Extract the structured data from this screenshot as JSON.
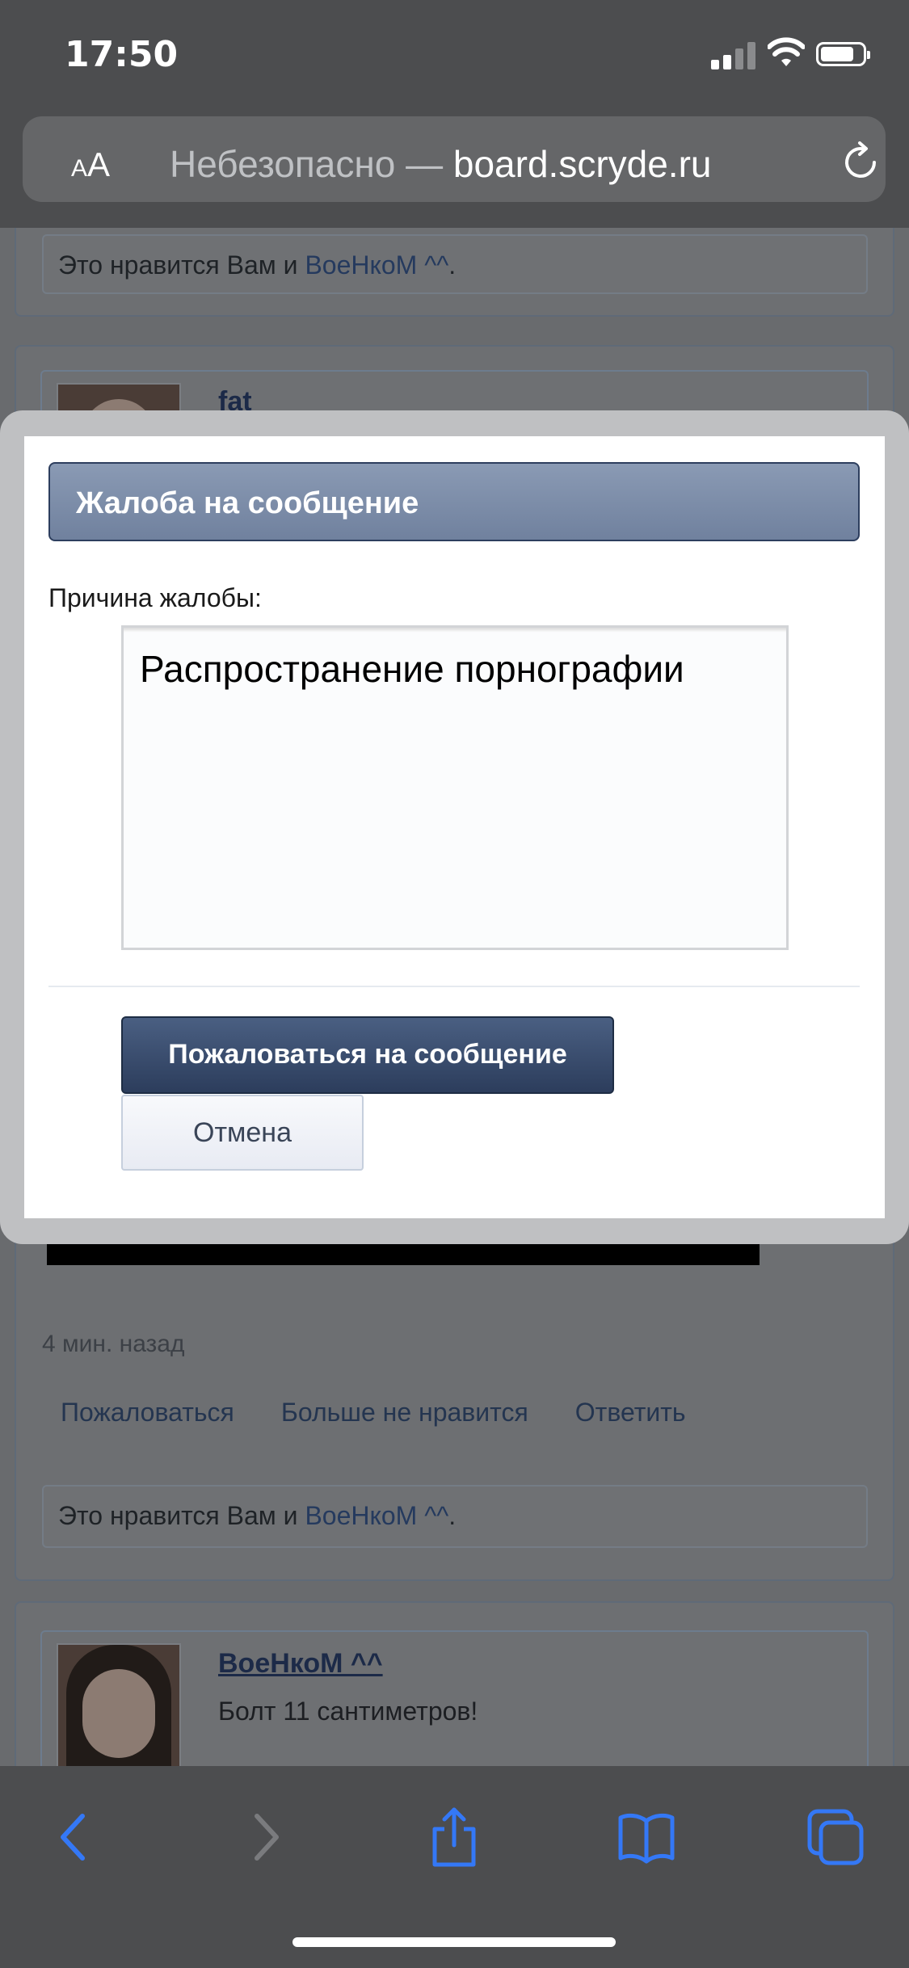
{
  "status_bar": {
    "time": "17:50"
  },
  "browser": {
    "text_size_label_small": "A",
    "text_size_label_large": "A",
    "url_insecure_label": "Небезопасно —",
    "url_domain": "board.scryde.ru"
  },
  "background_page": {
    "likes_top": {
      "prefix": "Это нравится Вам и",
      "user": "ВоеНкоМ ^^",
      "suffix": "."
    },
    "post1_author": "fat",
    "post_time": "4 мин. назад",
    "actions": [
      "Пожаловаться",
      "Больше не нравится",
      "Ответить"
    ],
    "likes_bottom": {
      "prefix": "Это нравится Вам и",
      "user": "ВоеНкоМ ^^",
      "suffix": "."
    },
    "post2_author": "ВоеНкоМ ^^",
    "post2_text": "Болт 11 сантиметров!"
  },
  "modal": {
    "title": "Жалоба на сообщение",
    "reason_label": "Причина жалобы:",
    "reason_value": "Распространение порнографии",
    "submit_label": "Пожаловаться на сообщение",
    "cancel_label": "Отмена"
  },
  "toolbar": {
    "icons": [
      "back-icon",
      "forward-icon",
      "share-icon",
      "bookmarks-icon",
      "tabs-icon"
    ],
    "accent": "#3478f6"
  }
}
